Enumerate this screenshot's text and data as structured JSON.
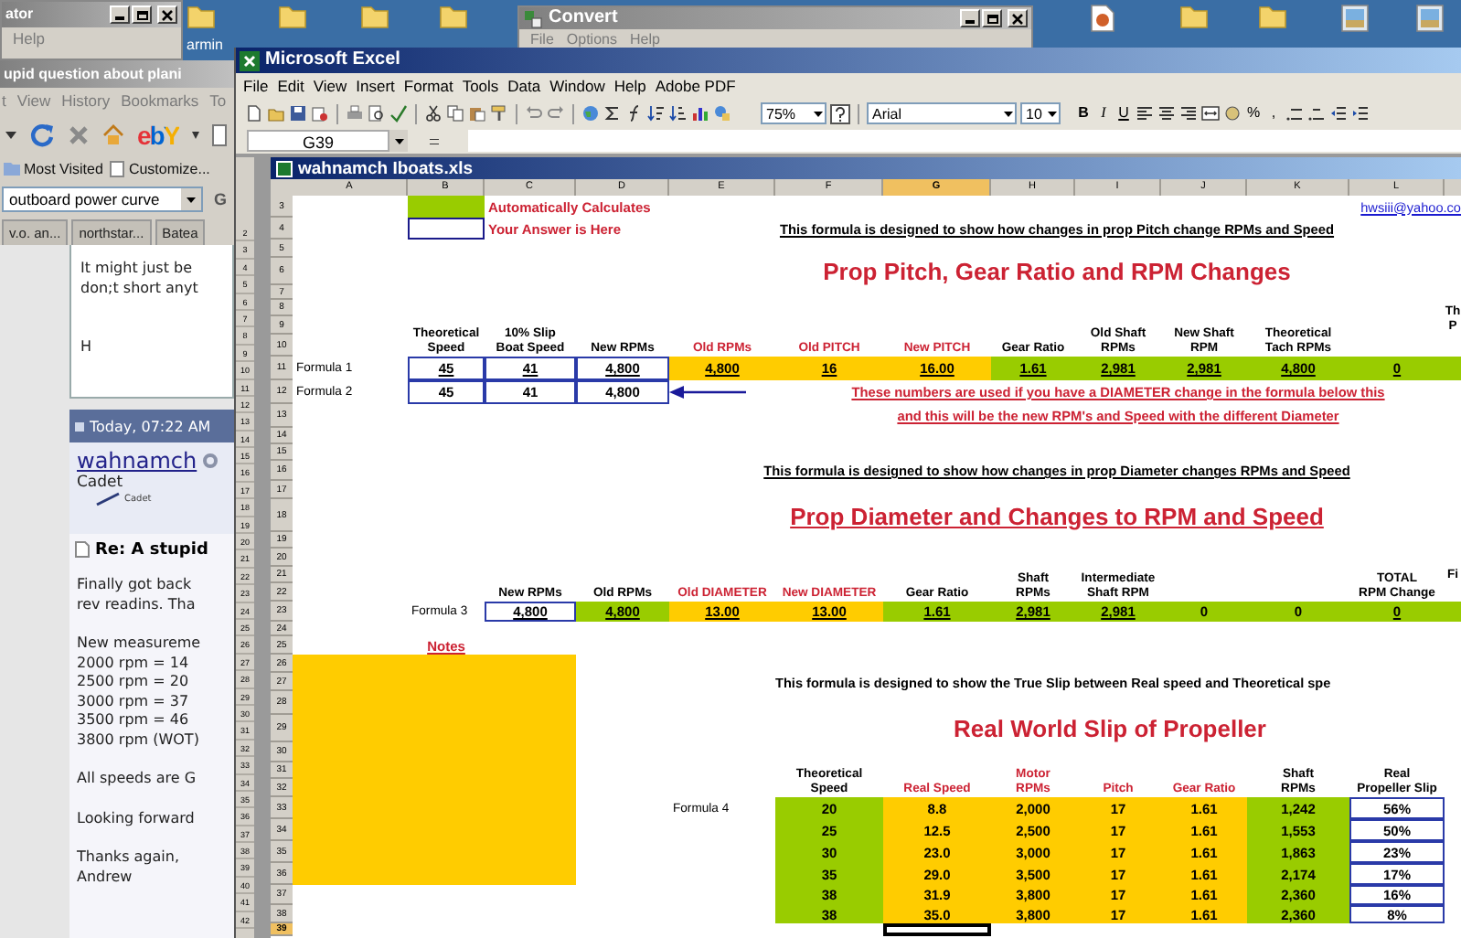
{
  "desktop": {
    "icon_label": "armin"
  },
  "back_window": {
    "title": "ator",
    "menu": [
      "Help"
    ]
  },
  "convert_window": {
    "title": "Convert",
    "menu": [
      "File",
      "Options",
      "Help"
    ]
  },
  "browser": {
    "title": "upid question about plani",
    "menu": [
      "t",
      "View",
      "History",
      "Bookmarks",
      "To"
    ],
    "logo_text": "ebY",
    "bookmarks": [
      "Most Visited",
      "Customize..."
    ],
    "search": {
      "value": "outboard power curve",
      "engine": "G"
    },
    "tabs": [
      {
        "label": "v.o. an...",
        "selected": false
      },
      {
        "label": "northstar...",
        "selected": false
      },
      {
        "label": "Batea",
        "selected": false
      }
    ],
    "previous_post": {
      "paragraphs": [
        [
          "It might just be",
          "don;t short anyt"
        ],
        [
          "H"
        ]
      ]
    },
    "post": {
      "date": "Today, 07:22 AM",
      "user": "wahnamch",
      "rank": "Cadet",
      "rank_badge": "Cadet",
      "title": "Re: A stupid",
      "paragraphs": [
        [
          "Finally got back",
          "rev readins. Tha"
        ],
        [
          "New measureme",
          "2000 rpm = 14",
          "2500 rpm = 20",
          "3000 rpm = 37",
          "3500 rpm = 46",
          "3800 rpm (WOT)"
        ],
        [
          "All speeds are G"
        ],
        [
          "Looking forward"
        ],
        [
          "Thanks again,",
          "Andrew"
        ]
      ]
    }
  },
  "excel": {
    "title": "Microsoft Excel",
    "menu": [
      "File",
      "Edit",
      "View",
      "Insert",
      "Format",
      "Tools",
      "Data",
      "Window",
      "Help",
      "Adobe PDF"
    ],
    "zoom": "75%",
    "font": "Arial",
    "font_size": "10",
    "format_buttons": [
      {
        "label": "B",
        "kind": "bold"
      },
      {
        "label": "I",
        "kind": "italic"
      },
      {
        "label": "U",
        "kind": "underline"
      }
    ],
    "number_buttons": [
      "%",
      ","
    ],
    "name_box": "G39",
    "back_rows": [
      "2",
      "3",
      "4",
      "5",
      "6",
      "7",
      "8",
      "9",
      "10",
      "11",
      "12",
      "13",
      "14",
      "15",
      "16",
      "17",
      "18",
      "19",
      "20",
      "21",
      "22",
      "23",
      "24",
      "25",
      "26",
      "27",
      "28",
      "29",
      "30",
      "31",
      "32",
      "33",
      "34",
      "35",
      "36",
      "37",
      "38",
      "39",
      "40",
      "41",
      "42"
    ],
    "workbook": {
      "title": "wahnamch Iboats.xls"
    },
    "sheet": {
      "columns": [
        {
          "label": "A",
          "selected": false
        },
        {
          "label": "B",
          "selected": false
        },
        {
          "label": "C",
          "selected": false
        },
        {
          "label": "D",
          "selected": false
        },
        {
          "label": "E",
          "selected": false
        },
        {
          "label": "F",
          "selected": false
        },
        {
          "label": "G",
          "selected": true
        },
        {
          "label": "H",
          "selected": false
        },
        {
          "label": "I",
          "selected": false
        },
        {
          "label": "J",
          "selected": false
        },
        {
          "label": "K",
          "selected": false
        },
        {
          "label": "L",
          "selected": false
        }
      ],
      "rows": [
        {
          "number": "3",
          "selected": false,
          "cells": [
            {
              "kind": "swatch-auto"
            },
            {
              "kind": "legend",
              "text": "Automatically Calculates"
            },
            {
              "kind": "link",
              "text": "hwsiii@yahoo.co"
            }
          ]
        },
        {
          "number": "4",
          "selected": false,
          "cells": [
            {
              "kind": "swatch-answer"
            },
            {
              "kind": "legend",
              "text": "Your Answer is Here"
            },
            {
              "kind": "caption",
              "text": "This formula is designed to show how changes in prop Pitch change RPMs and Speed"
            }
          ]
        },
        {
          "number": "5",
          "selected": false
        },
        {
          "number": "6",
          "selected": false,
          "cells": [
            {
              "kind": "title",
              "text": "Prop Pitch, Gear Ratio and RPM Changes"
            }
          ]
        },
        {
          "number": "7",
          "selected": false
        },
        {
          "number": "8",
          "selected": false
        },
        {
          "number": "9",
          "selected": false,
          "cells": [
            {
              "kind": "header",
              "lines": [
                "Th",
                "P"
              ]
            }
          ]
        },
        {
          "number": "10",
          "selected": false,
          "cells": [
            {
              "kind": "header",
              "lines": [
                "Theoretical",
                "Speed"
              ]
            },
            {
              "kind": "header",
              "lines": [
                "10% Slip",
                "Boat Speed"
              ]
            },
            {
              "kind": "header",
              "lines": [
                "New RPMs"
              ]
            },
            {
              "kind": "header-red",
              "lines": [
                "Old RPMs"
              ]
            },
            {
              "kind": "header-red",
              "lines": [
                "Old PITCH"
              ]
            },
            {
              "kind": "header-red",
              "lines": [
                "New PITCH"
              ]
            },
            {
              "kind": "header",
              "lines": [
                "Gear Ratio"
              ]
            },
            {
              "kind": "header",
              "lines": [
                "Old Shaft",
                "RPMs"
              ]
            },
            {
              "kind": "header",
              "lines": [
                "New Shaft",
                "RPM"
              ]
            },
            {
              "kind": "header",
              "lines": [
                "Theoretical",
                "Tach RPMs"
              ]
            }
          ]
        },
        {
          "number": "11",
          "selected": false,
          "cells": [
            {
              "kind": "label",
              "text": "Formula 1"
            },
            {
              "kind": "answer",
              "text": "45",
              "underline": true
            },
            {
              "kind": "answer",
              "text": "41",
              "underline": true
            },
            {
              "kind": "answer",
              "text": "4,800",
              "underline": true
            },
            {
              "kind": "input",
              "text": "4,800",
              "underline": true
            },
            {
              "kind": "input",
              "text": "16",
              "underline": true
            },
            {
              "kind": "input",
              "text": "16.00",
              "underline": true
            },
            {
              "kind": "auto",
              "text": "1.61",
              "underline": true
            },
            {
              "kind": "auto",
              "text": "2,981",
              "underline": true
            },
            {
              "kind": "auto",
              "text": "2,981",
              "underline": true
            },
            {
              "kind": "auto",
              "text": "4,800",
              "underline": true
            },
            {
              "kind": "auto",
              "text": "0",
              "underline": true
            },
            {
              "kind": "auto"
            }
          ]
        },
        {
          "number": "12",
          "selected": false,
          "cells": [
            {
              "kind": "label",
              "text": "Formula 2"
            },
            {
              "kind": "answer",
              "text": "45",
              "underline": false
            },
            {
              "kind": "answer",
              "text": "41",
              "underline": false
            },
            {
              "kind": "answer",
              "text": "4,800",
              "underline": false
            },
            {
              "kind": "arrow"
            },
            {
              "kind": "note",
              "text": "These numbers are used if you have a DIAMETER change in the formula below this"
            }
          ]
        },
        {
          "number": "13",
          "selected": false,
          "cells": [
            {
              "kind": "note",
              "text": "and this will be the new RPM's and Speed with the different Diameter"
            }
          ]
        },
        {
          "number": "14",
          "selected": false
        },
        {
          "number": "15",
          "selected": false
        },
        {
          "number": "16",
          "selected": false,
          "cells": [
            {
              "kind": "caption",
              "text": "This formula is designed to show how changes in prop Diameter changes RPMs and Speed"
            }
          ]
        },
        {
          "number": "17",
          "selected": false
        },
        {
          "number": "18",
          "selected": false,
          "cells": [
            {
              "kind": "title-underlined",
              "text": "Prop Diameter and Changes to RPM and Speed"
            }
          ]
        },
        {
          "number": "19",
          "selected": false
        },
        {
          "number": "20",
          "selected": false
        },
        {
          "number": "21",
          "selected": false,
          "cells": [
            {
              "kind": "header",
              "lines": [
                "Fi"
              ]
            }
          ]
        },
        {
          "number": "22",
          "selected": false,
          "cells": [
            {
              "kind": "header",
              "lines": [
                "New RPMs"
              ]
            },
            {
              "kind": "header",
              "lines": [
                "Old RPMs"
              ]
            },
            {
              "kind": "header-red",
              "lines": [
                "Old DIAMETER"
              ]
            },
            {
              "kind": "header-red",
              "lines": [
                "New DIAMETER"
              ]
            },
            {
              "kind": "header",
              "lines": [
                "Gear Ratio"
              ]
            },
            {
              "kind": "header",
              "lines": [
                "Shaft",
                "RPMs"
              ]
            },
            {
              "kind": "header",
              "lines": [
                "Intermediate",
                "Shaft RPM"
              ]
            },
            {
              "kind": "header",
              "lines": [
                "TOTAL",
                "RPM Change"
              ]
            }
          ]
        },
        {
          "number": "23",
          "selected": false,
          "cells": [
            {
              "kind": "label",
              "text": "Formula 3"
            },
            {
              "kind": "answer",
              "text": "4,800",
              "underline": true
            },
            {
              "kind": "auto",
              "text": "4,800",
              "underline": true
            },
            {
              "kind": "input",
              "text": "13.00",
              "underline": true
            },
            {
              "kind": "input",
              "text": "13.00",
              "underline": true
            },
            {
              "kind": "auto",
              "text": "1.61",
              "underline": true
            },
            {
              "kind": "auto",
              "text": "2,981",
              "underline": true
            },
            {
              "kind": "auto",
              "text": "2,981",
              "underline": true
            },
            {
              "kind": "auto",
              "text": "0",
              "underline": false
            },
            {
              "kind": "auto",
              "text": "0",
              "underline": false
            },
            {
              "kind": "auto",
              "text": "0",
              "underline": true
            },
            {
              "kind": "auto"
            }
          ]
        },
        {
          "number": "24",
          "selected": false
        },
        {
          "number": "25",
          "selected": false,
          "cells": [
            {
              "kind": "notes-heading",
              "text": "Notes"
            }
          ]
        },
        {
          "number": "26",
          "selected": false,
          "cells": [
            {
              "kind": "block"
            }
          ]
        },
        {
          "number": "27",
          "selected": false,
          "cells": [
            {
              "kind": "caption-plain",
              "text": "This formula is designed to show the True Slip between Real speed and Theoretical spe"
            }
          ]
        },
        {
          "number": "28",
          "selected": false
        },
        {
          "number": "29",
          "selected": false,
          "cells": [
            {
              "kind": "title",
              "text": "Real World Slip of Propeller"
            }
          ]
        },
        {
          "number": "30",
          "selected": false
        },
        {
          "number": "31",
          "selected": false
        },
        {
          "number": "32",
          "selected": false,
          "cells": [
            {
              "kind": "header",
              "lines": [
                "Theoretical",
                "Speed"
              ]
            },
            {
              "kind": "header-red",
              "lines": [
                "Real Speed"
              ]
            },
            {
              "kind": "header-red",
              "lines": [
                "Motor",
                "RPMs"
              ]
            },
            {
              "kind": "header-red",
              "lines": [
                "Pitch"
              ]
            },
            {
              "kind": "header-red",
              "lines": [
                "Gear Ratio"
              ]
            },
            {
              "kind": "header",
              "lines": [
                "Shaft",
                "RPMs"
              ]
            },
            {
              "kind": "header",
              "lines": [
                "Real",
                "Propeller Slip"
              ]
            }
          ]
        },
        {
          "number": "33",
          "selected": false,
          "cells": [
            {
              "kind": "label",
              "text": "Formula 4"
            },
            {
              "kind": "auto",
              "text": "20"
            },
            {
              "kind": "input",
              "text": "8.8"
            },
            {
              "kind": "input",
              "text": "2,000"
            },
            {
              "kind": "input",
              "text": "17"
            },
            {
              "kind": "input",
              "text": "1.61"
            },
            {
              "kind": "auto",
              "text": "1,242"
            },
            {
              "kind": "answer",
              "text": "56%"
            }
          ]
        },
        {
          "number": "34",
          "selected": false,
          "cells": [
            {
              "kind": "auto",
              "text": "25"
            },
            {
              "kind": "input",
              "text": "12.5"
            },
            {
              "kind": "input",
              "text": "2,500"
            },
            {
              "kind": "input",
              "text": "17"
            },
            {
              "kind": "input",
              "text": "1.61"
            },
            {
              "kind": "auto",
              "text": "1,553"
            },
            {
              "kind": "answer",
              "text": "50%"
            }
          ]
        },
        {
          "number": "35",
          "selected": false,
          "cells": [
            {
              "kind": "auto",
              "text": "30"
            },
            {
              "kind": "input",
              "text": "23.0"
            },
            {
              "kind": "input",
              "text": "3,000"
            },
            {
              "kind": "input",
              "text": "17"
            },
            {
              "kind": "input",
              "text": "1.61"
            },
            {
              "kind": "auto",
              "text": "1,863"
            },
            {
              "kind": "answer",
              "text": "23%"
            }
          ]
        },
        {
          "number": "36",
          "selected": false,
          "cells": [
            {
              "kind": "auto",
              "text": "35"
            },
            {
              "kind": "input",
              "text": "29.0"
            },
            {
              "kind": "input",
              "text": "3,500"
            },
            {
              "kind": "input",
              "text": "17"
            },
            {
              "kind": "input",
              "text": "1.61"
            },
            {
              "kind": "auto",
              "text": "2,174"
            },
            {
              "kind": "answer",
              "text": "17%"
            }
          ]
        },
        {
          "number": "37",
          "selected": false,
          "cells": [
            {
              "kind": "auto",
              "text": "38"
            },
            {
              "kind": "input",
              "text": "31.9"
            },
            {
              "kind": "input",
              "text": "3,800"
            },
            {
              "kind": "input",
              "text": "17"
            },
            {
              "kind": "input",
              "text": "1.61"
            },
            {
              "kind": "auto",
              "text": "2,360"
            },
            {
              "kind": "answer",
              "text": "16%"
            }
          ]
        },
        {
          "number": "38",
          "selected": false,
          "cells": [
            {
              "kind": "auto",
              "text": "38"
            },
            {
              "kind": "input",
              "text": "35.0"
            },
            {
              "kind": "input",
              "text": "3,800"
            },
            {
              "kind": "input",
              "text": "17"
            },
            {
              "kind": "input",
              "text": "1.61"
            },
            {
              "kind": "auto",
              "text": "2,360"
            },
            {
              "kind": "answer",
              "text": "8%"
            }
          ]
        },
        {
          "number": "39",
          "selected": true,
          "cells": [
            {
              "kind": "cursor"
            }
          ]
        }
      ]
    }
  }
}
